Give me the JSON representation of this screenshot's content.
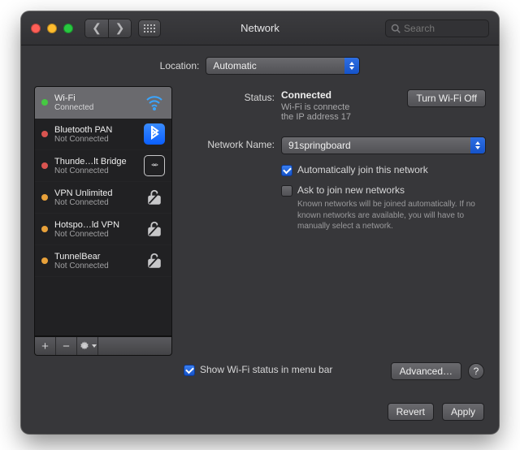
{
  "window": {
    "title": "Network",
    "search_placeholder": "Search"
  },
  "location": {
    "label": "Location:",
    "value": "Automatic"
  },
  "sidebar": {
    "items": [
      {
        "name": "Wi-Fi",
        "sub": "Connected",
        "status": "green",
        "icon": "wifi"
      },
      {
        "name": "Bluetooth PAN",
        "sub": "Not Connected",
        "status": "red",
        "icon": "bt"
      },
      {
        "name": "Thunde…lt Bridge",
        "sub": "Not Connected",
        "status": "red",
        "icon": "tb"
      },
      {
        "name": "VPN Unlimited",
        "sub": "Not Connected",
        "status": "orange",
        "icon": "lock"
      },
      {
        "name": "Hotspo…ld VPN",
        "sub": "Not Connected",
        "status": "orange",
        "icon": "lock"
      },
      {
        "name": "TunnelBear",
        "sub": "Not Connected",
        "status": "orange",
        "icon": "lock"
      }
    ]
  },
  "main": {
    "status_label": "Status:",
    "status_value": "Connected",
    "status_sub": "Wi-Fi is connecte\nthe IP address 17",
    "turn_off": "Turn Wi-Fi Off",
    "network_name_label": "Network Name:",
    "network_name_value": "91springboard",
    "auto_join": "Automatically join this network",
    "ask_join": "Ask to join new networks",
    "ask_join_hint": "Known networks will be joined automatically. If no known networks are available, you will have to manually select a network.",
    "show_menu_bar": "Show Wi-Fi status in menu bar",
    "advanced": "Advanced…",
    "help": "?"
  },
  "footer": {
    "revert": "Revert",
    "apply": "Apply"
  }
}
